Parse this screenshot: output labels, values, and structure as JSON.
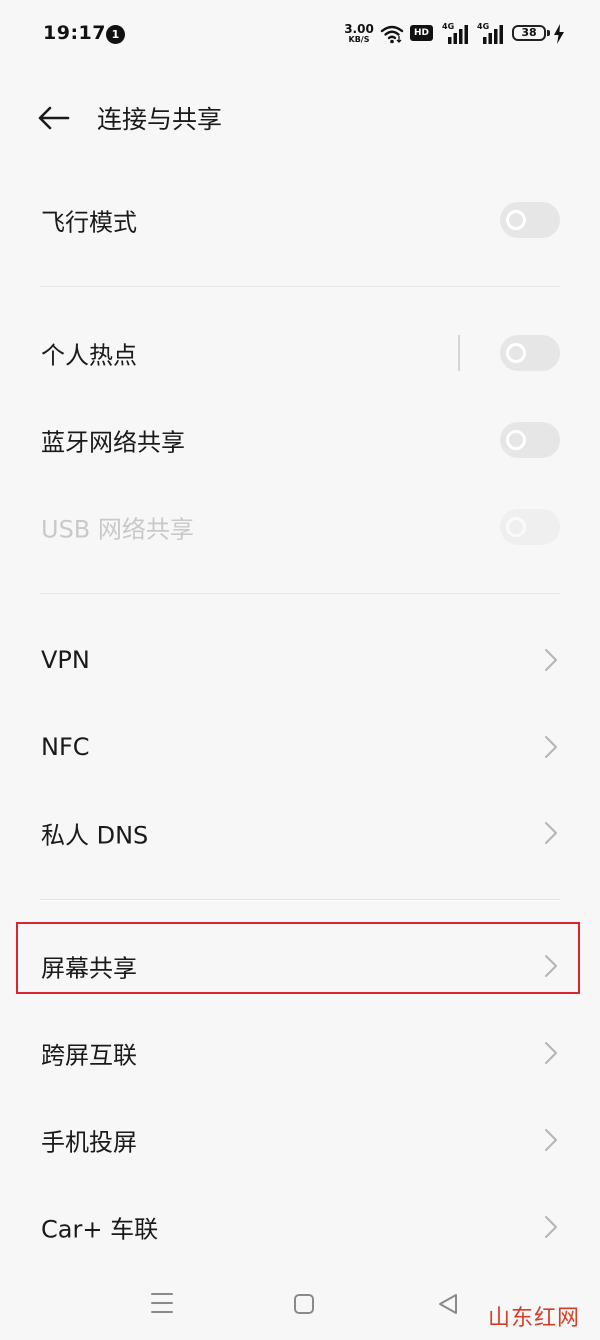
{
  "status_bar": {
    "time": "19:17",
    "notification_count": "1",
    "net_speed_value": "3.00",
    "net_speed_unit": "KB/S",
    "hd_label": "HD",
    "sim1_type": "4G",
    "sim2_type": "4G",
    "battery_level": "38"
  },
  "header": {
    "title": "连接与共享"
  },
  "rows": {
    "airplane": {
      "label": "飞行模式",
      "on": false
    },
    "hotspot": {
      "label": "个人热点",
      "on": false
    },
    "bt_tether": {
      "label": "蓝牙网络共享",
      "on": false
    },
    "usb_tether": {
      "label": "USB 网络共享",
      "on": false,
      "enabled": false
    },
    "vpn": {
      "label": "VPN"
    },
    "nfc": {
      "label": "NFC"
    },
    "private_dns": {
      "label": "私人 DNS"
    },
    "screen_share": {
      "label": "屏幕共享",
      "highlighted": true
    },
    "cross_screen": {
      "label": "跨屏互联"
    },
    "cast": {
      "label": "手机投屏"
    },
    "carplus": {
      "label": "Car+ 车联"
    }
  },
  "colors": {
    "background": "#f7f7f7",
    "toggle_off": "#e6e6e6",
    "highlight": "#d7262d",
    "watermark": "#d3402a"
  },
  "watermark": "山东红网",
  "icons": {
    "back": "arrow-left-icon",
    "chevron": "chevron-right-icon",
    "nav_menu": "menu-lines-icon",
    "nav_home": "square-home-icon",
    "nav_back": "triangle-back-icon"
  }
}
